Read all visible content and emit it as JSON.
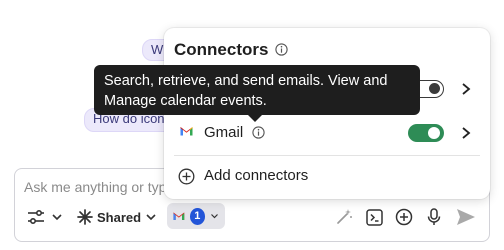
{
  "suggestions": [
    {
      "text": "Wh"
    },
    {
      "text": "How do icon"
    }
  ],
  "composer": {
    "placeholder": "Ask me anything or type",
    "shared_label": "Shared",
    "connectors_count": "1"
  },
  "popup": {
    "title": "Connectors",
    "rows": [
      {
        "label": "Gmail",
        "icon": "gmail-icon",
        "enabled": true
      }
    ],
    "add_label": "Add connectors"
  },
  "tooltip": {
    "line1": "Search, retrieve, and send emails. View and",
    "line2": "Manage calendar events."
  },
  "colors": {
    "toggle_on": "#2e8c56",
    "badge": "#2355d8",
    "chip_bg": "#ece9fb",
    "tooltip_bg": "#1e1e1e"
  }
}
